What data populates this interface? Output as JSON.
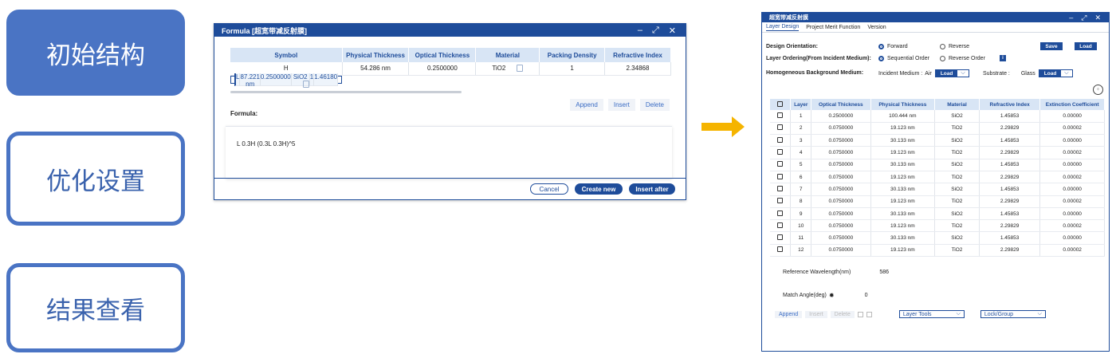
{
  "steps": [
    "初始结构",
    "优化设置",
    "结果查看"
  ],
  "formula_dialog": {
    "title": "Formula [超宽带减反射膜]",
    "columns": [
      "Symbol",
      "Physical Thickness",
      "Optical Thickness",
      "Material",
      "Packing Density",
      "Refractive Index"
    ],
    "rows": [
      [
        "H",
        "54.286 nm",
        "0.2500000",
        "TiO2",
        "1",
        "2.34868"
      ],
      [
        "L",
        "87.221 nm",
        "0.2500000",
        "SiO2",
        "1",
        "1.46180"
      ]
    ],
    "actions": [
      "Append",
      "Insert",
      "Delete"
    ],
    "formula_label": "Formula:",
    "formula_value": "L 0.3H (0.3L 0.3H)^5",
    "cancel": "Cancel",
    "create_new": "Create new",
    "insert_after": "Insert after"
  },
  "layer_window": {
    "title": "超宽带减反射膜",
    "tabs": [
      "Layer Design",
      "Project Merit Function",
      "Version"
    ],
    "design_orientation_label": "Design Orientation:",
    "orientation_forward": "Forward",
    "orientation_reverse": "Reverse",
    "save": "Save",
    "load": "Load",
    "layer_ordering_label": "Layer Ordering(From Incident Medium):",
    "ordering_sequential": "Sequential Order",
    "ordering_reverse": "Reverse Order",
    "info": "i",
    "background_label": "Homogeneous Background Medium:",
    "incident_medium_label": "Incident Medium :",
    "incident_medium_value": "Air",
    "substrate_label": "Substrate :",
    "substrate_value": "Glass",
    "columns": [
      "Layer",
      "Optical Thickness",
      "Physical Thickness",
      "Material",
      "Refractive Index",
      "Extinction Coefficient"
    ],
    "rows": [
      [
        "1",
        "0.2500000",
        "100.444 nm",
        "SiO2",
        "1.45853",
        "0.00000"
      ],
      [
        "2",
        "0.0750000",
        "19.123 nm",
        "TiO2",
        "2.29829",
        "0.00002"
      ],
      [
        "3",
        "0.0750000",
        "30.133 nm",
        "SiO2",
        "1.45853",
        "0.00000"
      ],
      [
        "4",
        "0.0750000",
        "19.123 nm",
        "TiO2",
        "2.29829",
        "0.00002"
      ],
      [
        "5",
        "0.0750000",
        "30.133 nm",
        "SiO2",
        "1.45853",
        "0.00000"
      ],
      [
        "6",
        "0.0750000",
        "19.123 nm",
        "TiO2",
        "2.29829",
        "0.00002"
      ],
      [
        "7",
        "0.0750000",
        "30.133 nm",
        "SiO2",
        "1.45853",
        "0.00000"
      ],
      [
        "8",
        "0.0750000",
        "19.123 nm",
        "TiO2",
        "2.29829",
        "0.00002"
      ],
      [
        "9",
        "0.0750000",
        "30.133 nm",
        "SiO2",
        "1.45853",
        "0.00000"
      ],
      [
        "10",
        "0.0750000",
        "19.123 nm",
        "TiO2",
        "2.29829",
        "0.00002"
      ],
      [
        "11",
        "0.0750000",
        "30.133 nm",
        "SiO2",
        "1.45853",
        "0.00000"
      ],
      [
        "12",
        "0.0750000",
        "19.123 nm",
        "TiO2",
        "2.29829",
        "0.00002"
      ]
    ],
    "reference_wavelength_label": "Reference Wavelength(nm)",
    "reference_wavelength_value": "586",
    "match_angle_label": "Match Angle(deg)",
    "match_angle_value": "0",
    "append": "Append",
    "insert": "Insert",
    "delete": "Delete",
    "layer_tools": "Layer Tools",
    "lock_group": "Lock/Group"
  },
  "colors": {
    "primary": "#1e4c9a",
    "step_fill": "#4a74c4",
    "arrow": "#f5b400",
    "header_bg": "#d8e5f5"
  }
}
